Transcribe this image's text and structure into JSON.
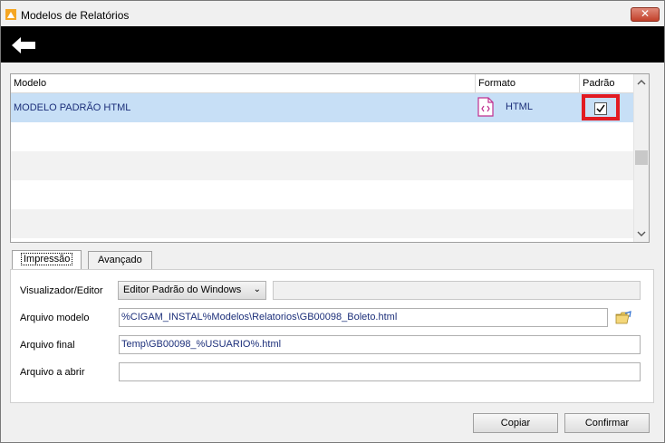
{
  "window": {
    "title": "Modelos de Relatórios",
    "close_label": "✕"
  },
  "grid": {
    "columns": [
      "Modelo",
      "Formato",
      "Padrão"
    ],
    "rows": [
      {
        "modelo": "MODELO PADRÃO HTML",
        "formato": "HTML",
        "padrao": true
      }
    ]
  },
  "tabs": [
    "Impressão",
    "Avançado"
  ],
  "form": {
    "visualizador_label": "Visualizador/Editor",
    "visualizador_value": "Editor Padrão do Windows",
    "arquivo_modelo_label": "Arquivo modelo",
    "arquivo_modelo_value": "%CIGAM_INSTAL%Modelos\\Relatorios\\GB00098_Boleto.html",
    "arquivo_final_label": "Arquivo final",
    "arquivo_final_value": "Temp\\GB00098_%USUARIO%.html",
    "arquivo_abrir_label": "Arquivo a abrir",
    "arquivo_abrir_value": ""
  },
  "buttons": {
    "copiar": "Copiar",
    "confirmar": "Confirmar"
  },
  "icons": {
    "app": "app-icon",
    "back": "back-arrow-icon",
    "format": "html-file-icon",
    "folder": "open-folder-icon"
  },
  "colors": {
    "selection": "#c7dff6",
    "highlight": "#e21b22",
    "toolbar": "#000000"
  }
}
